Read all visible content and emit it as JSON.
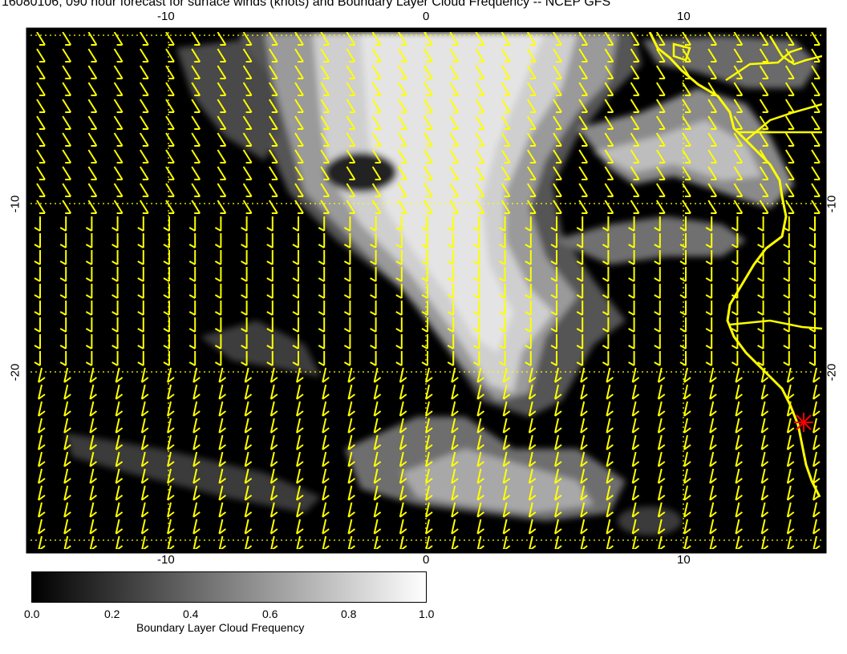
{
  "title": "16080106, 090 hour forecast for surface winds (knots) and Boundary Layer Cloud Frequency -- NCEP GFS",
  "map": {
    "x_ticks_top": [
      "-10",
      "0",
      "10"
    ],
    "x_ticks_bottom": [
      "-10",
      "0",
      "10"
    ],
    "y_ticks_left": [
      "-10",
      "-20"
    ],
    "y_ticks_right": [
      "-10",
      "-20"
    ],
    "lon_range": [
      -15.5,
      15.5
    ],
    "lat_range": [
      -32.5,
      -2.5
    ],
    "grid_lines": "dotted-yellow",
    "wind_barb_color": "#ffff00",
    "coastline_color": "#ffff00",
    "marker": {
      "symbol": "red-star",
      "color": "#ff0000"
    }
  },
  "colorbar": {
    "title": "Boundary Layer Cloud Frequency",
    "labels": [
      "0.0",
      "0.2",
      "0.4",
      "0.6",
      "0.8",
      "1.0"
    ],
    "range": [
      0.0,
      1.0
    ],
    "colors": [
      "#000000",
      "#ffffff"
    ]
  }
}
